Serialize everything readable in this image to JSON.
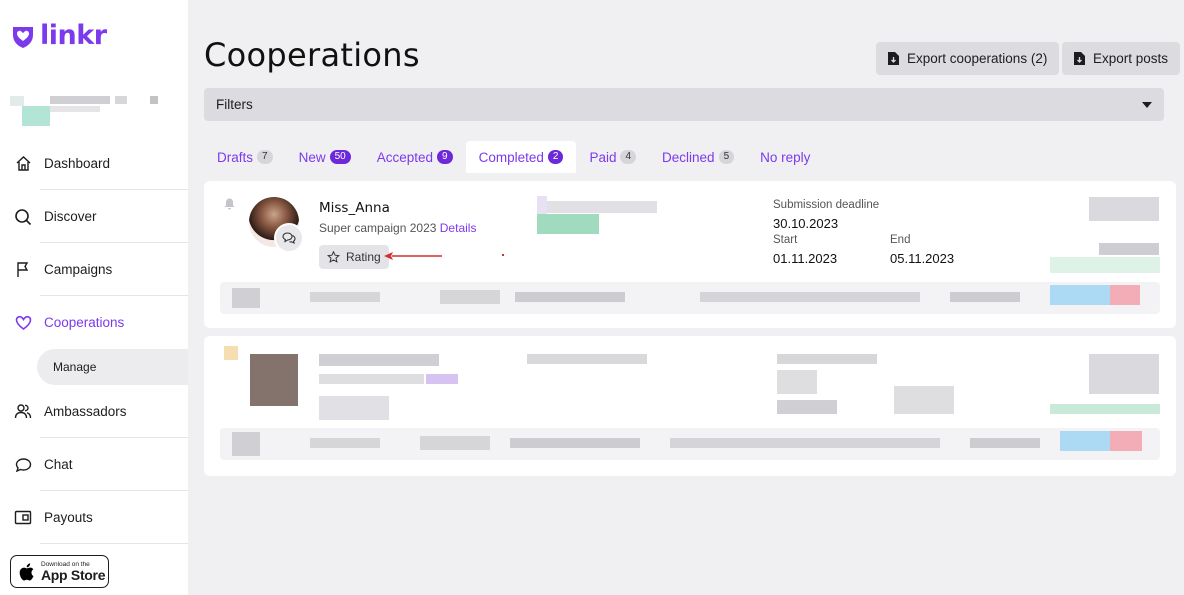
{
  "app": {
    "logo_text": "linkr"
  },
  "sidebar": {
    "items": [
      {
        "label": "Dashboard",
        "icon": "home-icon"
      },
      {
        "label": "Discover",
        "icon": "search-icon"
      },
      {
        "label": "Campaigns",
        "icon": "flag-icon"
      },
      {
        "label": "Cooperations",
        "icon": "heart-icon",
        "active": true
      },
      {
        "label": "Ambassadors",
        "icon": "users-icon"
      },
      {
        "label": "Chat",
        "icon": "chat-icon"
      },
      {
        "label": "Payouts",
        "icon": "wallet-icon"
      }
    ],
    "sub_item": "Manage",
    "app_store": {
      "small": "Download on the",
      "big": "App Store"
    }
  },
  "header": {
    "title": "Cooperations",
    "export_cooperations": "Export cooperations (2)",
    "export_posts": "Export posts"
  },
  "filters": {
    "label": "Filters"
  },
  "tabs": [
    {
      "label": "Drafts",
      "count": "7",
      "badge": "grey"
    },
    {
      "label": "New",
      "count": "50",
      "badge": "purple"
    },
    {
      "label": "Accepted",
      "count": "9",
      "badge": "purple"
    },
    {
      "label": "Completed",
      "count": "2",
      "badge": "purple",
      "active": true
    },
    {
      "label": "Paid",
      "count": "4",
      "badge": "grey"
    },
    {
      "label": "Declined",
      "count": "5",
      "badge": "grey"
    },
    {
      "label": "No reply",
      "count": "",
      "badge": ""
    }
  ],
  "cooperation": {
    "name": "Miss_Anna",
    "campaign": "Super campaign 2023",
    "details_link": "Details",
    "rating_label": "Rating",
    "submission_deadline_label": "Submission deadline",
    "submission_deadline": "30.10.2023",
    "start_label": "Start",
    "start": "01.11.2023",
    "end_label": "End",
    "end": "05.11.2023"
  },
  "colors": {
    "accent": "#7c3aed",
    "arrow": "#d32f2f"
  }
}
